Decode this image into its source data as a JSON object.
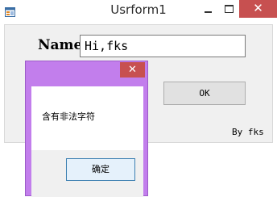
{
  "window": {
    "title": "Usrform1",
    "close_glyph": "✕"
  },
  "form": {
    "name_label": "Name",
    "name_value": "Hi,fks",
    "ok_label": "OK",
    "byline": "By fks"
  },
  "dialog": {
    "message": "含有非法字符",
    "confirm_label": "确定",
    "close_glyph": "✕"
  },
  "colors": {
    "dialog_frame": "#c27eec",
    "close_red": "#c75050",
    "client_bg": "#f0f0f0"
  },
  "icons": {
    "app": "form-icon",
    "minimize": "minimize-icon",
    "maximize": "maximize-icon",
    "close": "close-icon"
  }
}
